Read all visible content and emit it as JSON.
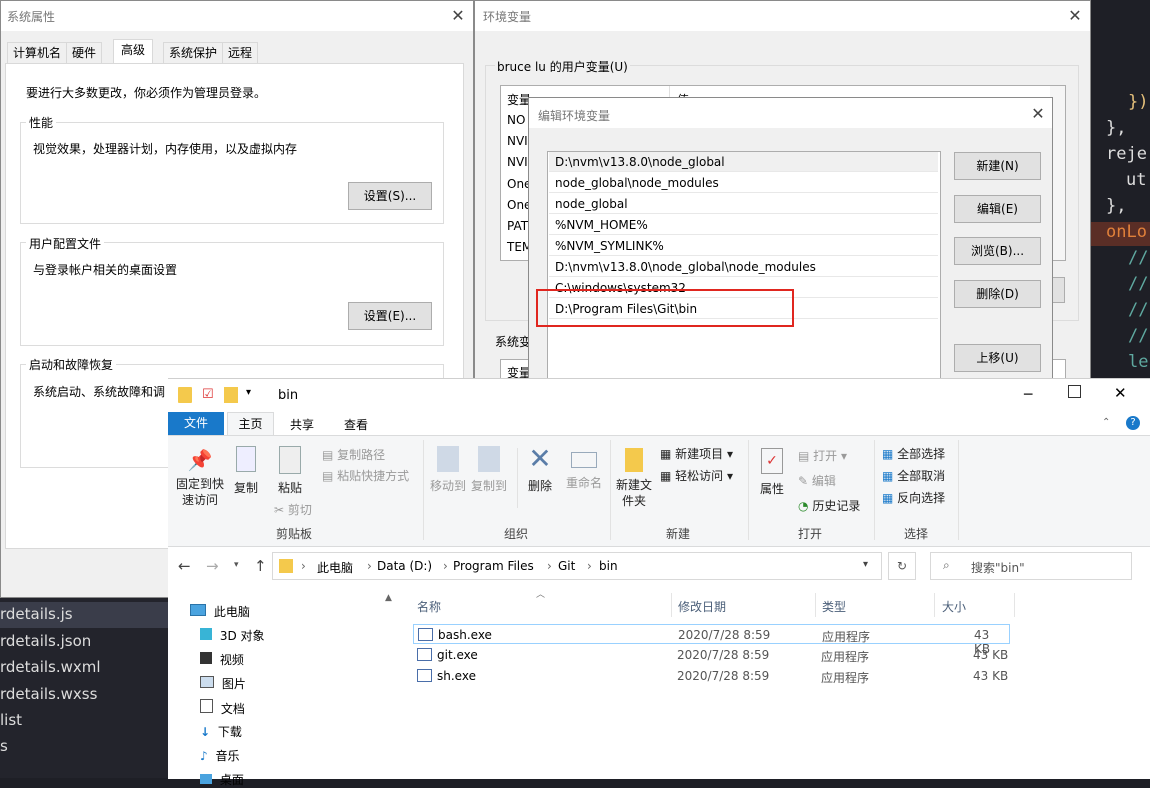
{
  "code": {
    "lines": [
      "}),",
      "},",
      "reje",
      "ut",
      "},",
      "onLo",
      "//",
      "//",
      "//",
      "//",
      "le"
    ]
  },
  "files": [
    "rdetails.js",
    "rdetails.json",
    "rdetails.wxml",
    "rdetails.wxss",
    "list",
    "s"
  ],
  "sysprop": {
    "title": "系统属性",
    "tabs": [
      "计算机名",
      "硬件",
      "高级",
      "系统保护",
      "远程"
    ],
    "admin_note": "要进行大多数更改，你必须作为管理员登录。",
    "perf": {
      "label": "性能",
      "desc": "视觉效果，处理器计划，内存使用，以及虚拟内存",
      "button": "设置(S)..."
    },
    "profile": {
      "label": "用户配置文件",
      "desc": "与登录帐户相关的桌面设置",
      "button": "设置(E)..."
    },
    "startup": {
      "label": "启动和故障恢复",
      "desc": "系统启动、系统故障和调"
    }
  },
  "envvars": {
    "title": "环境变量",
    "user_group": "bruce lu 的用户变量(U)",
    "col_var": "变量",
    "col_val": "值",
    "user_rows": [
      "NO",
      "NVI",
      "NVI",
      "One",
      "One",
      "PAT",
      "TEM"
    ],
    "sys_group": "系统变",
    "sys_col_var": "变量"
  },
  "editenv": {
    "title": "编辑环境变量",
    "items": [
      "D:\\nvm\\v13.8.0\\node_global",
      "node_global\\node_modules",
      "node_global",
      "%NVM_HOME%",
      "%NVM_SYMLINK%",
      "D:\\nvm\\v13.8.0\\node_global\\node_modules",
      "C:\\windows\\system32",
      "D:\\Program Files\\Git\\bin"
    ],
    "buttons": {
      "new": "新建(N)",
      "edit": "编辑(E)",
      "browse": "浏览(B)...",
      "delete": "删除(D)",
      "up": "上移(U)"
    }
  },
  "explorer": {
    "title": "bin",
    "ribbon_tabs": [
      "文件",
      "主页",
      "共享",
      "查看"
    ],
    "clipboard": {
      "pin": "固定到快速访问",
      "copy": "复制",
      "paste": "粘贴",
      "copy_path": "复制路径",
      "paste_shortcut": "粘贴快捷方式",
      "cut": "剪切",
      "group": "剪贴板"
    },
    "organize": {
      "move_to": "移动到",
      "copy_to": "复制到",
      "delete": "删除",
      "rename": "重命名",
      "group": "组织"
    },
    "new": {
      "new_folder": "新建文件夹",
      "new_item": "新建项目",
      "easy_access": "轻松访问",
      "group": "新建"
    },
    "open": {
      "properties": "属性",
      "open": "打开",
      "edit": "编辑",
      "history": "历史记录",
      "group": "打开"
    },
    "select": {
      "select_all": "全部选择",
      "select_none": "全部取消",
      "invert": "反向选择",
      "group": "选择"
    },
    "breadcrumb": [
      "此电脑",
      "Data (D:)",
      "Program Files",
      "Git",
      "bin"
    ],
    "search_placeholder": "搜索\"bin\"",
    "nav": [
      "此电脑",
      "3D 对象",
      "视频",
      "图片",
      "文档",
      "下载",
      "音乐",
      "桌面"
    ],
    "columns": {
      "name": "名称",
      "date": "修改日期",
      "type": "类型",
      "size": "大小"
    },
    "rows": [
      {
        "name": "bash.exe",
        "date": "2020/7/28 8:59",
        "type": "应用程序",
        "size": "43 KB"
      },
      {
        "name": "git.exe",
        "date": "2020/7/28 8:59",
        "type": "应用程序",
        "size": "43 KB"
      },
      {
        "name": "sh.exe",
        "date": "2020/7/28 8:59",
        "type": "应用程序",
        "size": "43 KB"
      }
    ]
  },
  "colors": {
    "accent": "#1979ca",
    "highlight_box": "#e0261f",
    "editor_bg": "#1e1f26"
  }
}
